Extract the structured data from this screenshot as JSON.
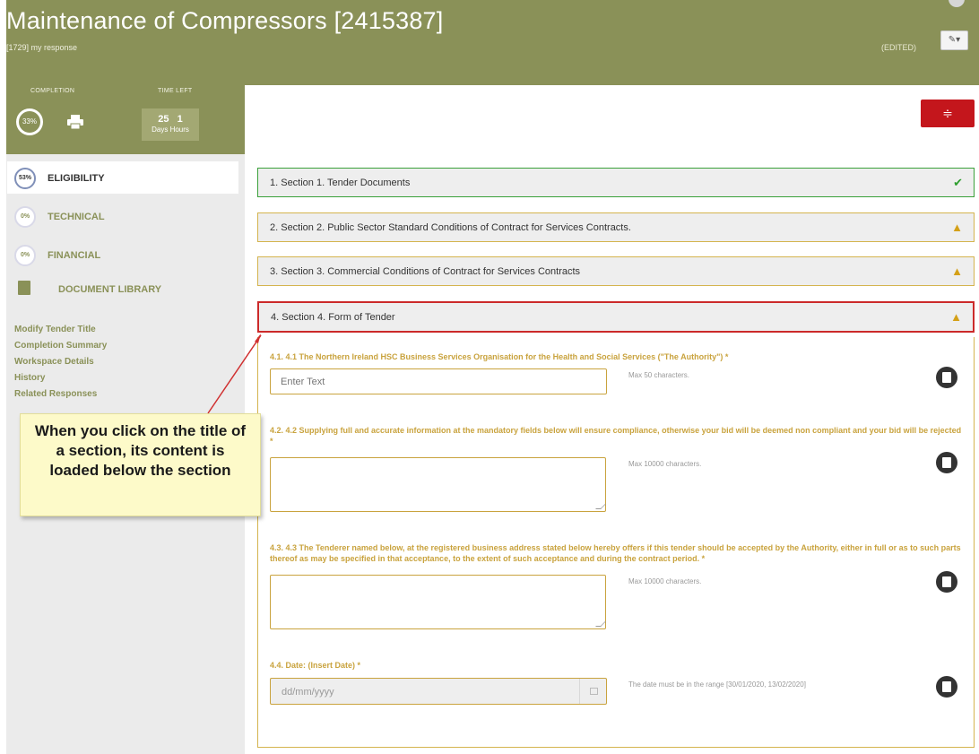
{
  "header": {
    "title": "Maintenance of Compressors [2415387]",
    "subtitle": "[1729] my response",
    "edited": "(EDITED)",
    "edit_icon": "edit-dropdown-icon"
  },
  "progress": {
    "completion_label": "COMPLETION",
    "completion_value": "33%",
    "time_left_label": "TIME LEFT",
    "days": "25",
    "hours": "1",
    "days_label": "Days",
    "hours_label": "Hours"
  },
  "nav": {
    "items": [
      {
        "pct": "53%",
        "label": "ELIGIBILITY"
      },
      {
        "pct": "0%",
        "label": "TECHNICAL"
      },
      {
        "pct": "0%",
        "label": "FINANCIAL"
      },
      {
        "pct": "",
        "label": "DOCUMENT LIBRARY"
      }
    ],
    "links": [
      "Modify Tender Title",
      "Completion Summary",
      "Workspace Details",
      "History",
      "Related Responses"
    ]
  },
  "sections": [
    {
      "title": "1. Section 1. Tender Documents",
      "status": "complete"
    },
    {
      "title": "2. Section 2. Public Sector Standard Conditions of Contract for Services Contracts.",
      "status": "warning"
    },
    {
      "title": "3. Section 3. Commercial Conditions of Contract for Services Contracts",
      "status": "warning"
    },
    {
      "title": "4. Section 4. Form of Tender",
      "status": "warning"
    }
  ],
  "questions": [
    {
      "label": "4.1. 4.1 The Northern Ireland HSC Business Services Organisation for the Health and Social Services (\"The Authority\") *",
      "placeholder": "Enter Text",
      "hint": "Max 50 characters."
    },
    {
      "label": "4.2. 4.2 Supplying full and accurate information at the mandatory fields below will ensure compliance, otherwise your bid will be deemed non compliant and your bid will be rejected *",
      "hint": "Max 10000 characters."
    },
    {
      "label": "4.3. 4.3 The Tenderer named below, at the registered business address stated below hereby offers if this tender should be accepted by the Authority, either in full or as to such parts thereof as may be specified in that acceptance, to the extent of such acceptance and during the contract period. *",
      "hint": "Max 10000 characters."
    },
    {
      "label": "4.4. Date: (Insert Date) *",
      "placeholder": "dd/mm/yyyy",
      "hint": "The date must be in the range [30/01/2020, 13/02/2020]"
    }
  ],
  "callout": {
    "text": "When you click on the title of a section, its content is loaded below the section"
  },
  "colors": {
    "olive": "#8a9158",
    "gold": "#c9a33e",
    "red": "#c4161c",
    "green": "#2e9e2e"
  }
}
